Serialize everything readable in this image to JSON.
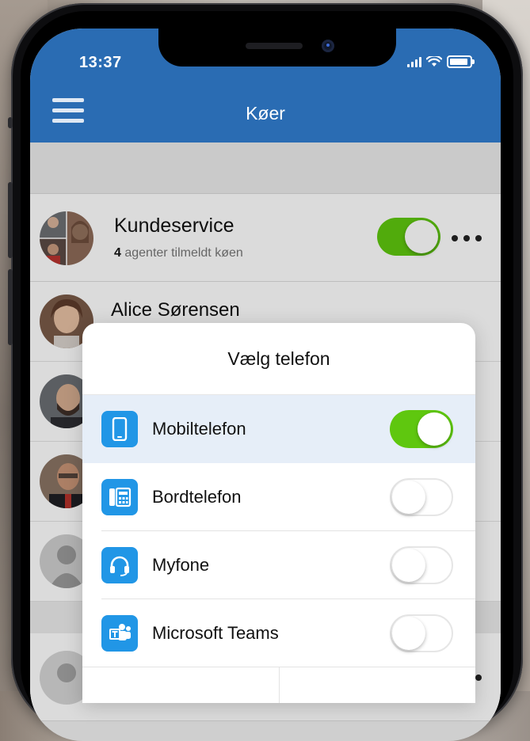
{
  "status_bar": {
    "time": "13:37"
  },
  "header": {
    "title": "Køer"
  },
  "queue": {
    "name": "Kundeservice",
    "agent_count": "4",
    "agents_text": " agenter tilmeldt køen",
    "enabled": true
  },
  "agents": [
    {
      "name": "Alice Sørensen"
    },
    {
      "name": ""
    },
    {
      "name": ""
    },
    {
      "name": ""
    }
  ],
  "modal": {
    "title": "Vælg telefon",
    "options": [
      {
        "label": "Mobiltelefon",
        "icon": "mobile-phone-icon",
        "enabled": true,
        "selected": true
      },
      {
        "label": "Bordtelefon",
        "icon": "desk-phone-icon",
        "enabled": false
      },
      {
        "label": "Myfone",
        "icon": "headset-icon",
        "enabled": false
      },
      {
        "label": "Microsoft Teams",
        "icon": "microsoft-teams-icon",
        "enabled": false
      }
    ]
  },
  "colors": {
    "header": "#2a6cb3",
    "toggle_on": "#5fc70f",
    "option_icon": "#2196e6",
    "selected_row": "#e6eef8"
  }
}
